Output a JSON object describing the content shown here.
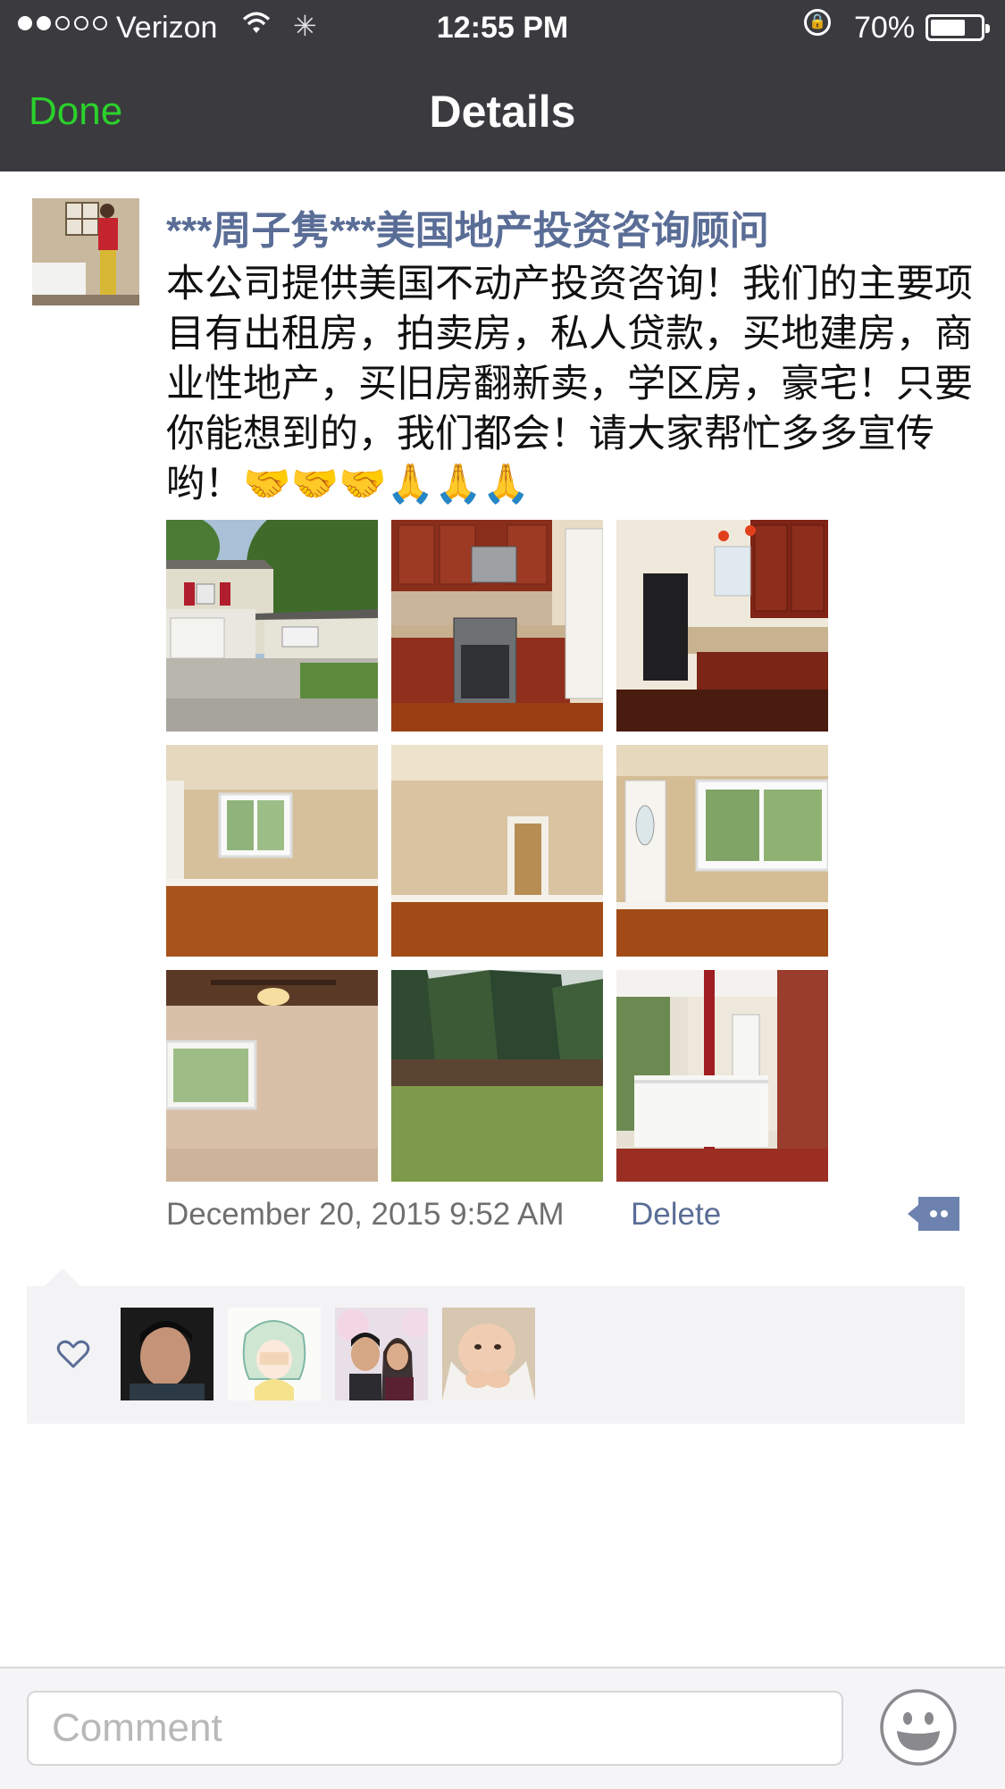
{
  "status_bar": {
    "carrier": "Verizon",
    "time": "12:55 PM",
    "battery": "70%",
    "battery_level": 0.7
  },
  "nav": {
    "done_label": "Done",
    "title": "Details"
  },
  "post": {
    "author": "***周子隽***美国地产投资咨询顾问",
    "text": "本公司提供美国不动产投资咨询！我们的主要项目有出租房，拍卖房，私人贷款，买地建房，商业性地产，买旧房翻新卖，学区房，豪宅！只要你能想到的，我们都会！请大家帮忙多多宣传哟！🤝🤝🤝🙏🙏🙏",
    "photos": [
      {
        "icon": "house-exterior-photo"
      },
      {
        "icon": "kitchen-photo"
      },
      {
        "icon": "kitchen-fridge-photo"
      },
      {
        "icon": "living-room-photo"
      },
      {
        "icon": "hallway-photo"
      },
      {
        "icon": "front-door-room-photo"
      },
      {
        "icon": "bedroom-ceiling-fan-photo"
      },
      {
        "icon": "backyard-photo"
      },
      {
        "icon": "front-porch-photo"
      }
    ],
    "timestamp": "December 20, 2015 9:52 AM",
    "delete_label": "Delete"
  },
  "likes": {
    "icon": "heart-icon",
    "avatars": [
      "liker-avatar-1",
      "liker-avatar-2",
      "liker-avatar-3",
      "liker-avatar-4"
    ]
  },
  "comment": {
    "placeholder": "Comment"
  },
  "colors": {
    "nav_bg": "#3b3b3f",
    "done_green": "#2bd12b",
    "link_blue": "#5a6d96",
    "likes_bg": "#f3f3f5"
  }
}
